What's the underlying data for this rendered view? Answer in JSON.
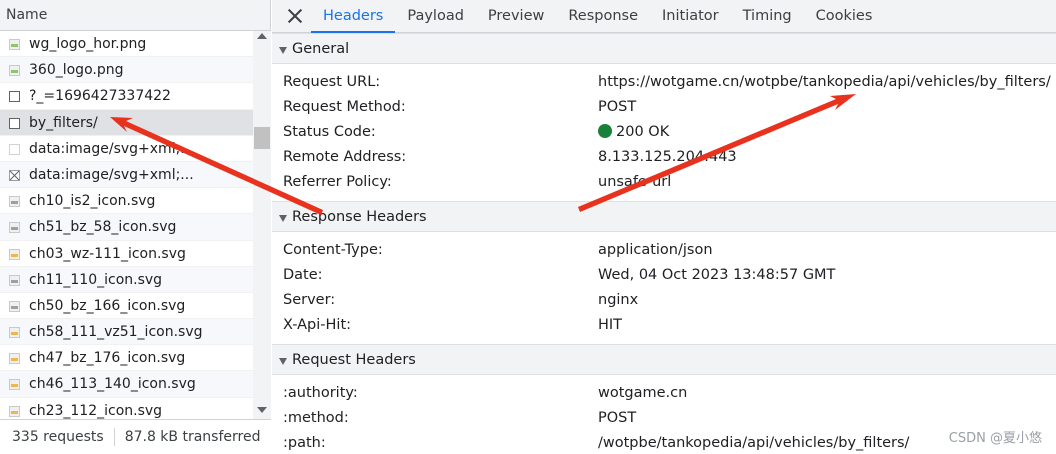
{
  "list_header": "Name",
  "requests": [
    {
      "name": "wg_logo_hor.png",
      "icon": "image-icon",
      "type": "green"
    },
    {
      "name": "360_logo.png",
      "icon": "image-icon",
      "type": "green"
    },
    {
      "name": "?_=1696427337422",
      "icon": "document-icon",
      "type": "doc"
    },
    {
      "name": "by_filters/",
      "icon": "document-icon",
      "type": "doc",
      "selected": true
    },
    {
      "name": "data:image/svg+xml;...",
      "icon": "blank-image-icon",
      "type": "blank"
    },
    {
      "name": "data:image/svg+xml;...",
      "icon": "broken-image-icon",
      "type": "broken"
    },
    {
      "name": "ch10_is2_icon.svg",
      "icon": "image-icon",
      "type": "gray"
    },
    {
      "name": "ch51_bz_58_icon.svg",
      "icon": "image-icon",
      "type": "gray"
    },
    {
      "name": "ch03_wz-111_icon.svg",
      "icon": "image-icon",
      "type": "yellow"
    },
    {
      "name": "ch11_110_icon.svg",
      "icon": "image-icon",
      "type": "gray"
    },
    {
      "name": "ch50_bz_166_icon.svg",
      "icon": "image-icon",
      "type": "gray"
    },
    {
      "name": "ch58_111_vz51_icon.svg",
      "icon": "image-icon",
      "type": "yellow"
    },
    {
      "name": "ch47_bz_176_icon.svg",
      "icon": "image-icon",
      "type": "yellow"
    },
    {
      "name": "ch46_113_140_icon.svg",
      "icon": "image-icon",
      "type": "yellow"
    },
    {
      "name": "ch23_112_icon.svg",
      "icon": "image-icon",
      "type": "yellow"
    }
  ],
  "status_bar": {
    "requests": "335 requests",
    "transferred": "87.8 kB transferred"
  },
  "tabs": [
    "Headers",
    "Payload",
    "Preview",
    "Response",
    "Initiator",
    "Timing",
    "Cookies"
  ],
  "active_tab": "Headers",
  "sections": [
    {
      "title": "General",
      "rows": [
        {
          "key": "Request URL:",
          "value": "https://wotgame.cn/wotpbe/tankopedia/api/vehicles/by_filters/"
        },
        {
          "key": "Request Method:",
          "value": "POST"
        },
        {
          "key": "Status Code:",
          "value": "200 OK",
          "status_dot": true
        },
        {
          "key": "Remote Address:",
          "value": "8.133.125.204:443"
        },
        {
          "key": "Referrer Policy:",
          "value": "unsafe-url"
        }
      ]
    },
    {
      "title": "Response Headers",
      "rows": [
        {
          "key": "Content-Type:",
          "value": "application/json"
        },
        {
          "key": "Date:",
          "value": "Wed, 04 Oct 2023 13:48:57 GMT"
        },
        {
          "key": "Server:",
          "value": "nginx"
        },
        {
          "key": "X-Api-Hit:",
          "value": "HIT"
        }
      ]
    },
    {
      "title": "Request Headers",
      "rows": [
        {
          "key": ":authority:",
          "value": "wotgame.cn"
        },
        {
          "key": ":method:",
          "value": "POST"
        },
        {
          "key": ":path:",
          "value": "/wotpbe/tankopedia/api/vehicles/by_filters/"
        }
      ]
    }
  ],
  "watermark": "CSDN @夏小悠",
  "colors": {
    "accent": "#1a73e8",
    "status_ok": "#188038",
    "annotation_arrow": "#e8321e"
  }
}
